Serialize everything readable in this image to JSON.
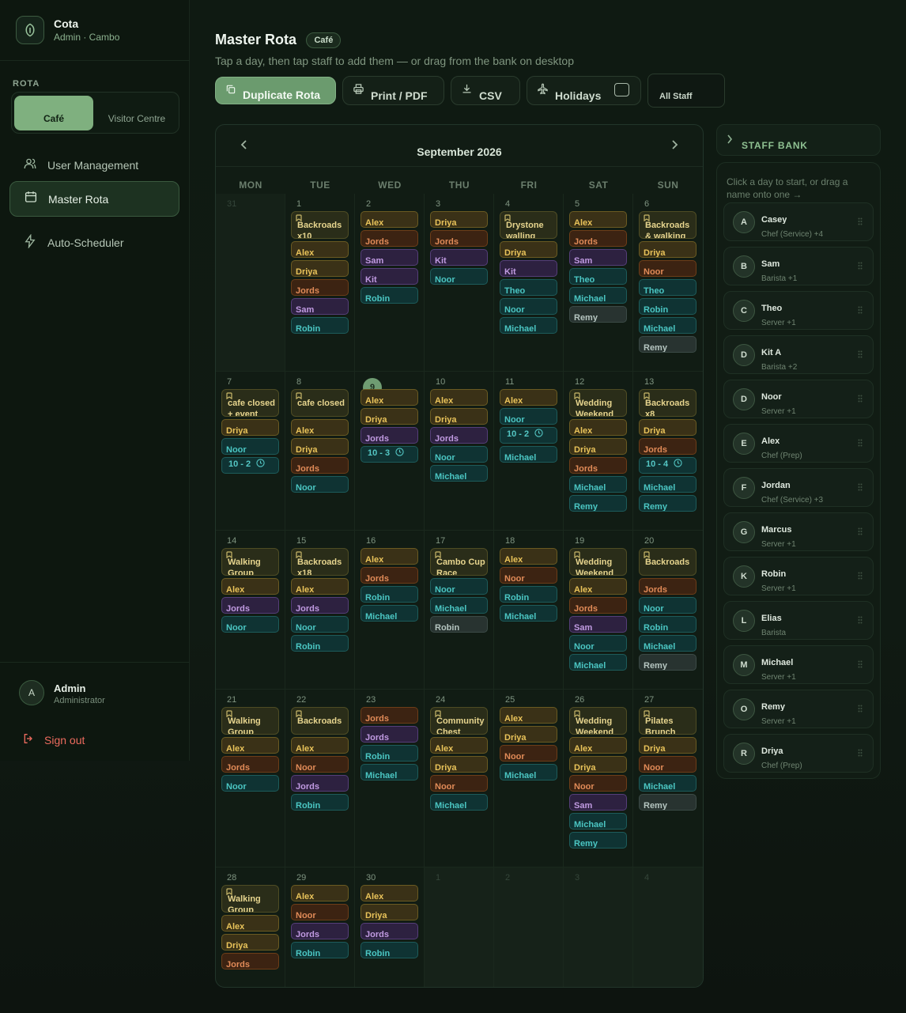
{
  "brand": {
    "name": "Cota",
    "sub": "Admin · Cambo",
    "logo_icon": "leaf-shield-icon"
  },
  "sidebar": {
    "section_label": "ROTA",
    "rota_options": [
      "Café",
      "Visitor Centre"
    ],
    "selected_rota": "Café",
    "nav": [
      {
        "label": "User Management",
        "icon": "users-icon"
      },
      {
        "label": "Master Rota",
        "icon": "calendar-icon",
        "active": true
      },
      {
        "label": "Auto-Scheduler",
        "icon": "lightning-icon"
      }
    ],
    "user": {
      "initial": "A",
      "name": "Admin",
      "role": "Administrator"
    },
    "sign_out": "Sign out"
  },
  "header": {
    "title": "Master Rota",
    "badge": "Café",
    "subtitle": "Tap a day, then tap staff to add them — or drag from the bank on desktop"
  },
  "toolbar": {
    "duplicate": "Duplicate Rota",
    "print": "Print / PDF",
    "csv": "CSV",
    "holidays": "Holidays",
    "staff_filter": "All Staff"
  },
  "calendar": {
    "month": "September 2026",
    "weekdays": [
      "MON",
      "TUE",
      "WED",
      "THU",
      "FRI",
      "SAT",
      "SUN"
    ],
    "today": "9",
    "weeks": [
      [
        {
          "day": "31",
          "other": true,
          "events": []
        },
        {
          "day": "1",
          "events": [
            {
              "kind": "event",
              "text": "Backroads x10"
            },
            {
              "text": "Alex",
              "color": "y"
            },
            {
              "text": "Driya",
              "color": "y"
            },
            {
              "text": "Jords",
              "color": "o"
            },
            {
              "text": "Sam",
              "color": "p"
            },
            {
              "text": "Robin",
              "color": "t"
            }
          ]
        },
        {
          "day": "2",
          "events": [
            {
              "text": "Alex",
              "color": "y"
            },
            {
              "text": "Jords",
              "color": "o"
            },
            {
              "text": "Sam",
              "color": "p"
            },
            {
              "text": "Kit",
              "color": "p"
            },
            {
              "text": "Robin",
              "color": "t"
            }
          ]
        },
        {
          "day": "3",
          "events": [
            {
              "text": "Driya",
              "color": "y"
            },
            {
              "text": "Jords",
              "color": "o"
            },
            {
              "text": "Kit",
              "color": "p"
            },
            {
              "text": "Noor",
              "color": "t"
            }
          ]
        },
        {
          "day": "4",
          "events": [
            {
              "kind": "event",
              "text": "Drystone walling"
            },
            {
              "text": "Driya",
              "color": "y"
            },
            {
              "text": "Kit",
              "color": "p"
            },
            {
              "text": "Theo",
              "color": "t"
            },
            {
              "text": "Noor",
              "color": "t"
            },
            {
              "text": "Michael",
              "color": "t"
            }
          ]
        },
        {
          "day": "5",
          "events": [
            {
              "text": "Alex",
              "color": "y"
            },
            {
              "text": "Jords",
              "color": "o"
            },
            {
              "text": "Sam",
              "color": "p"
            },
            {
              "text": "Theo",
              "color": "t"
            },
            {
              "text": "Michael",
              "color": "t"
            },
            {
              "text": "Remy",
              "color": "g"
            }
          ]
        },
        {
          "day": "6",
          "events": [
            {
              "kind": "event",
              "text": "Backroads & walking"
            },
            {
              "text": "Driya",
              "color": "y"
            },
            {
              "text": "Noor",
              "color": "o"
            },
            {
              "text": "Theo",
              "color": "t"
            },
            {
              "text": "Robin",
              "color": "t"
            },
            {
              "text": "Michael",
              "color": "t"
            },
            {
              "text": "Remy",
              "color": "g"
            }
          ]
        }
      ],
      [
        {
          "day": "7",
          "events": [
            {
              "kind": "event",
              "text": "cafe closed + event"
            },
            {
              "text": "Driya",
              "color": "y"
            },
            {
              "text": "Noor",
              "color": "t"
            },
            {
              "kind": "time",
              "text": "10 - 2"
            }
          ]
        },
        {
          "day": "8",
          "events": [
            {
              "kind": "event",
              "text": "cafe closed"
            },
            {
              "text": "Alex",
              "color": "y"
            },
            {
              "text": "Driya",
              "color": "y"
            },
            {
              "text": "Jords",
              "color": "o"
            },
            {
              "text": "Noor",
              "color": "t"
            }
          ]
        },
        {
          "day": "9",
          "events": [
            {
              "text": "Alex",
              "color": "y"
            },
            {
              "text": "Driya",
              "color": "y"
            },
            {
              "text": "Jords",
              "color": "p"
            },
            {
              "kind": "time",
              "text": "10 - 3"
            }
          ]
        },
        {
          "day": "10",
          "events": [
            {
              "text": "Alex",
              "color": "y"
            },
            {
              "text": "Driya",
              "color": "y"
            },
            {
              "text": "Jords",
              "color": "p"
            },
            {
              "text": "Noor",
              "color": "t"
            },
            {
              "text": "Michael",
              "color": "t"
            }
          ]
        },
        {
          "day": "11",
          "events": [
            {
              "text": "Alex",
              "color": "y"
            },
            {
              "text": "Noor",
              "color": "t"
            },
            {
              "kind": "time",
              "text": "10 - 2"
            },
            {
              "text": "Michael",
              "color": "t"
            }
          ]
        },
        {
          "day": "12",
          "events": [
            {
              "kind": "event",
              "text": "Wedding Weekend"
            },
            {
              "text": "Alex",
              "color": "y"
            },
            {
              "text": "Driya",
              "color": "y"
            },
            {
              "text": "Jords",
              "color": "o"
            },
            {
              "text": "Michael",
              "color": "t"
            },
            {
              "text": "Remy",
              "color": "t"
            }
          ]
        },
        {
          "day": "13",
          "events": [
            {
              "kind": "event",
              "text": "Backroads x8"
            },
            {
              "text": "Driya",
              "color": "y"
            },
            {
              "text": "Jords",
              "color": "o"
            },
            {
              "kind": "time",
              "text": "10 - 4"
            },
            {
              "text": "Michael",
              "color": "t"
            },
            {
              "text": "Remy",
              "color": "t"
            }
          ]
        }
      ],
      [
        {
          "day": "14",
          "events": [
            {
              "kind": "event",
              "text": "Walking Group"
            },
            {
              "text": "Alex",
              "color": "y"
            },
            {
              "text": "Jords",
              "color": "p"
            },
            {
              "text": "Noor",
              "color": "t"
            }
          ]
        },
        {
          "day": "15",
          "events": [
            {
              "kind": "event",
              "text": "Backroads x18"
            },
            {
              "text": "Alex",
              "color": "y"
            },
            {
              "text": "Jords",
              "color": "p"
            },
            {
              "text": "Noor",
              "color": "t"
            },
            {
              "text": "Robin",
              "color": "t"
            }
          ]
        },
        {
          "day": "16",
          "events": [
            {
              "text": "Alex",
              "color": "y"
            },
            {
              "text": "Jords",
              "color": "o"
            },
            {
              "text": "Robin",
              "color": "t"
            },
            {
              "text": "Michael",
              "color": "t"
            }
          ]
        },
        {
          "day": "17",
          "events": [
            {
              "kind": "event",
              "text": "Cambo Cup Race"
            },
            {
              "text": "Noor",
              "color": "t"
            },
            {
              "text": "Michael",
              "color": "t"
            },
            {
              "text": "Robin",
              "color": "g"
            }
          ]
        },
        {
          "day": "18",
          "events": [
            {
              "text": "Alex",
              "color": "y"
            },
            {
              "text": "Noor",
              "color": "o"
            },
            {
              "text": "Robin",
              "color": "t"
            },
            {
              "text": "Michael",
              "color": "t"
            }
          ]
        },
        {
          "day": "19",
          "events": [
            {
              "kind": "event",
              "text": "Wedding Weekend"
            },
            {
              "text": "Alex",
              "color": "y"
            },
            {
              "text": "Jords",
              "color": "o"
            },
            {
              "text": "Sam",
              "color": "p"
            },
            {
              "text": "Noor",
              "color": "t"
            },
            {
              "text": "Michael",
              "color": "t"
            }
          ]
        },
        {
          "day": "20",
          "events": [
            {
              "kind": "event",
              "text": "Backroads"
            },
            {
              "text": "Jords",
              "color": "o"
            },
            {
              "text": "Noor",
              "color": "t"
            },
            {
              "text": "Robin",
              "color": "t"
            },
            {
              "text": "Michael",
              "color": "t"
            },
            {
              "text": "Remy",
              "color": "g"
            }
          ]
        }
      ],
      [
        {
          "day": "21",
          "events": [
            {
              "kind": "event",
              "text": "Walking Group"
            },
            {
              "text": "Alex",
              "color": "y"
            },
            {
              "text": "Jords",
              "color": "o"
            },
            {
              "text": "Noor",
              "color": "t"
            }
          ]
        },
        {
          "day": "22",
          "events": [
            {
              "kind": "event",
              "text": "Backroads"
            },
            {
              "text": "Alex",
              "color": "y"
            },
            {
              "text": "Noor",
              "color": "o"
            },
            {
              "text": "Jords",
              "color": "p"
            },
            {
              "text": "Robin",
              "color": "t"
            }
          ]
        },
        {
          "day": "23",
          "events": [
            {
              "text": "Jords",
              "color": "o"
            },
            {
              "text": "Jords",
              "color": "p"
            },
            {
              "text": "Robin",
              "color": "t"
            },
            {
              "text": "Michael",
              "color": "t"
            }
          ]
        },
        {
          "day": "24",
          "events": [
            {
              "kind": "event",
              "text": "Community Chest"
            },
            {
              "text": "Alex",
              "color": "y"
            },
            {
              "text": "Driya",
              "color": "y"
            },
            {
              "text": "Noor",
              "color": "o"
            },
            {
              "text": "Michael",
              "color": "t"
            }
          ]
        },
        {
          "day": "25",
          "events": [
            {
              "text": "Alex",
              "color": "y"
            },
            {
              "text": "Driya",
              "color": "y"
            },
            {
              "text": "Noor",
              "color": "o"
            },
            {
              "text": "Michael",
              "color": "t"
            }
          ]
        },
        {
          "day": "26",
          "events": [
            {
              "kind": "event",
              "text": "Wedding Weekend"
            },
            {
              "text": "Alex",
              "color": "y"
            },
            {
              "text": "Driya",
              "color": "y"
            },
            {
              "text": "Noor",
              "color": "o"
            },
            {
              "text": "Sam",
              "color": "p"
            },
            {
              "text": "Michael",
              "color": "t"
            },
            {
              "text": "Remy",
              "color": "t"
            }
          ]
        },
        {
          "day": "27",
          "events": [
            {
              "kind": "event",
              "text": "Pilates Brunch"
            },
            {
              "text": "Driya",
              "color": "y"
            },
            {
              "text": "Noor",
              "color": "o"
            },
            {
              "text": "Michael",
              "color": "t"
            },
            {
              "text": "Remy",
              "color": "g"
            }
          ]
        }
      ],
      [
        {
          "day": "28",
          "events": [
            {
              "kind": "event",
              "text": "Walking Group"
            },
            {
              "text": "Alex",
              "color": "y"
            },
            {
              "text": "Driya",
              "color": "y"
            },
            {
              "text": "Jords",
              "color": "o"
            }
          ]
        },
        {
          "day": "29",
          "events": [
            {
              "text": "Alex",
              "color": "y"
            },
            {
              "text": "Noor",
              "color": "o"
            },
            {
              "text": "Jords",
              "color": "p"
            },
            {
              "text": "Robin",
              "color": "t"
            }
          ]
        },
        {
          "day": "30",
          "events": [
            {
              "text": "Alex",
              "color": "y"
            },
            {
              "text": "Driya",
              "color": "y"
            },
            {
              "text": "Jords",
              "color": "p"
            },
            {
              "text": "Robin",
              "color": "t"
            }
          ]
        },
        {
          "day": "1",
          "other": true,
          "events": []
        },
        {
          "day": "2",
          "other": true,
          "events": []
        },
        {
          "day": "3",
          "other": true,
          "events": []
        },
        {
          "day": "4",
          "other": true,
          "events": []
        }
      ]
    ]
  },
  "bank": {
    "title": "STAFF BANK",
    "hint": "Click a day to start, or drag a name onto one →",
    "staff": [
      {
        "initial": "A",
        "name": "Casey",
        "role": "Chef (Service) +4"
      },
      {
        "initial": "B",
        "name": "Sam",
        "role": "Barista +1"
      },
      {
        "initial": "C",
        "name": "Theo",
        "role": "Server +1"
      },
      {
        "initial": "D",
        "name": "Kit A",
        "role": "Barista +2"
      },
      {
        "initial": "D",
        "name": "Noor",
        "role": "Server +1"
      },
      {
        "initial": "E",
        "name": "Alex",
        "role": "Chef (Prep)"
      },
      {
        "initial": "F",
        "name": "Jordan",
        "role": "Chef (Service) +3"
      },
      {
        "initial": "G",
        "name": "Marcus",
        "role": "Server +1"
      },
      {
        "initial": "K",
        "name": "Robin",
        "role": "Server +1"
      },
      {
        "initial": "L",
        "name": "Elias",
        "role": "Barista"
      },
      {
        "initial": "M",
        "name": "Michael",
        "role": "Server +1"
      },
      {
        "initial": "O",
        "name": "Remy",
        "role": "Server +1"
      },
      {
        "initial": "R",
        "name": "Driya",
        "role": "Chef (Prep)"
      }
    ]
  },
  "colors": {
    "accent": "#7fb07f",
    "chip_yellow": "#e9c35a",
    "chip_orange": "#e18b58",
    "chip_purple": "#c19be2",
    "chip_teal": "#4bc6c3",
    "chip_grey": "#b5c5c0",
    "danger": "#ec6b5e"
  }
}
